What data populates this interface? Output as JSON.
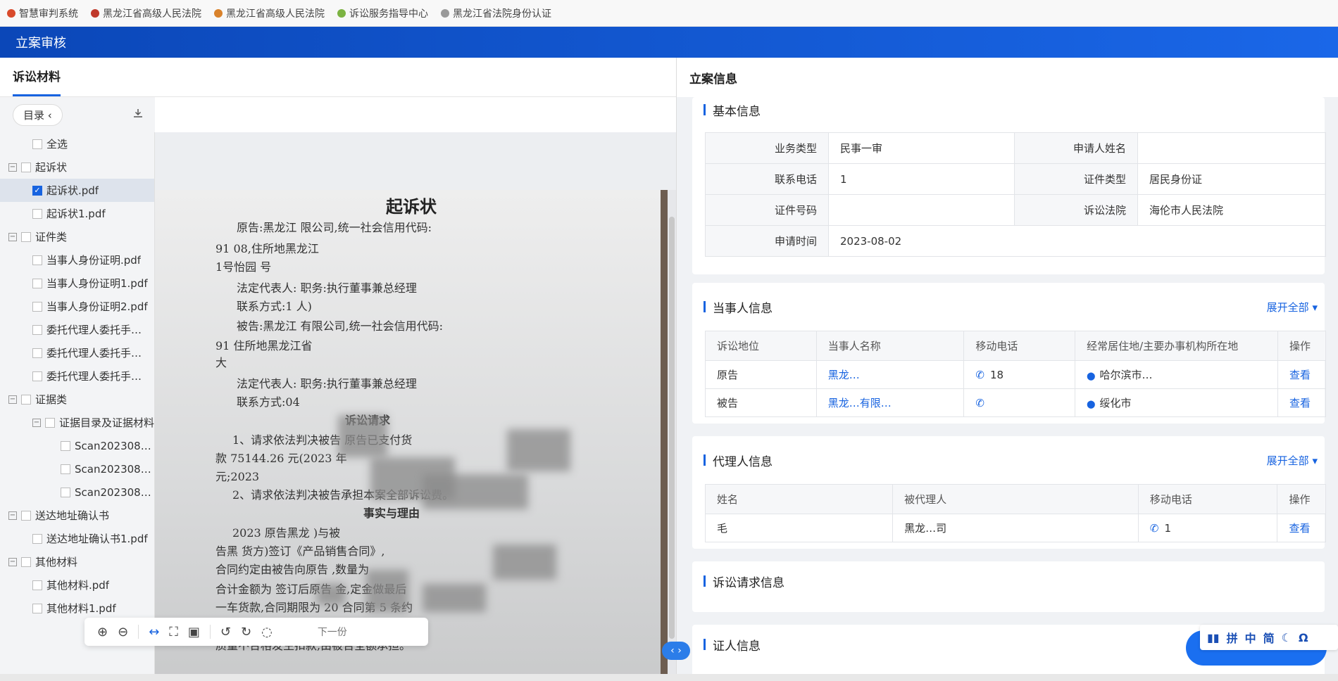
{
  "bookmarks": [
    {
      "label": "智慧审判系统",
      "icon": "court-icon"
    },
    {
      "label": "黑龙江省高级人民法院",
      "icon": "court-icon"
    },
    {
      "label": "黑龙江省高级人民法院",
      "icon": "emblem-icon"
    },
    {
      "label": "诉讼服务指导中心",
      "icon": "leaf-icon"
    },
    {
      "label": "黑龙江省法院身份认证",
      "icon": "page-icon"
    }
  ],
  "app": {
    "title": "立案审核"
  },
  "left": {
    "tab": "诉讼材料",
    "catalog_label": "目录",
    "tree": [
      {
        "label": "全选",
        "level": 1,
        "toggle": "",
        "checked": false
      },
      {
        "label": "起诉状",
        "level": 0,
        "toggle": "−",
        "checked": false
      },
      {
        "label": "起诉状.pdf",
        "level": 1,
        "toggle": "",
        "checked": true,
        "selected": true
      },
      {
        "label": "起诉状1.pdf",
        "level": 1,
        "toggle": "",
        "checked": false
      },
      {
        "label": "证件类",
        "level": 0,
        "toggle": "−",
        "checked": false
      },
      {
        "label": "当事人身份证明.pdf",
        "level": 1,
        "toggle": "",
        "checked": false
      },
      {
        "label": "当事人身份证明1.pdf",
        "level": 1,
        "toggle": "",
        "checked": false
      },
      {
        "label": "当事人身份证明2.pdf",
        "level": 1,
        "toggle": "",
        "checked": false
      },
      {
        "label": "委托代理人委托手…",
        "level": 1,
        "toggle": "",
        "checked": false
      },
      {
        "label": "委托代理人委托手…",
        "level": 1,
        "toggle": "",
        "checked": false
      },
      {
        "label": "委托代理人委托手…",
        "level": 1,
        "toggle": "",
        "checked": false
      },
      {
        "label": "证据类",
        "level": 0,
        "toggle": "−",
        "checked": false
      },
      {
        "label": "证据目录及证据材料",
        "level": 0,
        "toggle": "−",
        "checked": false,
        "indent": 1
      },
      {
        "label": "Scan2023080…",
        "level": 2,
        "toggle": "",
        "checked": false
      },
      {
        "label": "Scan2023080…",
        "level": 2,
        "toggle": "",
        "checked": false
      },
      {
        "label": "Scan2023080…",
        "level": 2,
        "toggle": "",
        "checked": false
      },
      {
        "label": "送达地址确认书",
        "level": 0,
        "toggle": "−",
        "checked": false
      },
      {
        "label": "送达地址确认书1.pdf",
        "level": 1,
        "toggle": "",
        "checked": false
      },
      {
        "label": "其他材料",
        "level": 0,
        "toggle": "−",
        "checked": false
      },
      {
        "label": "其他材料.pdf",
        "level": 1,
        "toggle": "",
        "checked": false
      },
      {
        "label": "其他材料1.pdf",
        "level": 1,
        "toggle": "",
        "checked": false
      }
    ],
    "document": {
      "title": "起诉状",
      "lines": [
        "原告:黑龙江          限公司,统一社会信用代码:",
        "91              08,住所地黑龙江",
        "1号怡园                      号",
        "法定代表人:          职务:执行董事兼总经理",
        "联系方式:1              人)",
        "被告:黑龙江              有限公司,统一社会信用代码:",
        "91                   住所地黑龙江省",
        "大",
        "法定代表人:          职务:执行董事兼总经理",
        "联系方式:04",
        "诉讼请求",
        "1、请求依法判决被告                          原告已支付货",
        "款 75144.26 元(2023 年",
        "元;2023",
        "2、请求依法判决被告承担本案全部诉讼费。",
        "事实与理由",
        "2023              原告黑龙                    )与被",
        "告黑                        货方)签订《产品销售合同》,",
        "合同约定由被告向原告                        ,数量为",
        "合计金额为                签订后原告              金,定金做最后",
        "一车货款,合同期限为 20                       合同第 5 条约",
        "定质量标准以                                验结果为准,如有",
        "质量不合格发生扣款,由被告全额承担。"
      ],
      "toolbar_next": "下一份"
    }
  },
  "right": {
    "title": "立案信息",
    "basic": {
      "title": "基本信息",
      "rows": [
        {
          "k1": "业务类型",
          "v1": "民事一审",
          "k2": "申请人姓名",
          "v2": ""
        },
        {
          "k1": "联系电话",
          "v1": "1",
          "k2": "证件类型",
          "v2": "居民身份证"
        },
        {
          "k1": "证件号码",
          "v1": "",
          "k2": "诉讼法院",
          "v2": "海伦市人民法院"
        },
        {
          "k1": "申请时间",
          "v1": "2023-08-02",
          "k2": "",
          "v2": ""
        }
      ]
    },
    "parties": {
      "title": "当事人信息",
      "expand": "展开全部",
      "headers": [
        "诉讼地位",
        "当事人名称",
        "移动电话",
        "经常居住地/主要办事机构所在地",
        "操作"
      ],
      "rows": [
        {
          "role": "原告",
          "name": "黑龙…",
          "phone": "18",
          "addr": "哈尔滨市…",
          "op": "查看"
        },
        {
          "role": "被告",
          "name": "黑龙…有限…",
          "phone": "",
          "addr": "绥化市",
          "op": "查看"
        }
      ]
    },
    "agents": {
      "title": "代理人信息",
      "expand": "展开全部",
      "headers": [
        "姓名",
        "被代理人",
        "移动电话",
        "操作"
      ],
      "rows": [
        {
          "name": "毛",
          "principal": "黑龙…司",
          "phone": "1",
          "op": "查看"
        }
      ]
    },
    "claims": {
      "title": "诉讼请求信息"
    },
    "witness": {
      "title": "证人信息"
    }
  },
  "ime": {
    "labels": [
      "拼",
      "中",
      "简"
    ]
  }
}
